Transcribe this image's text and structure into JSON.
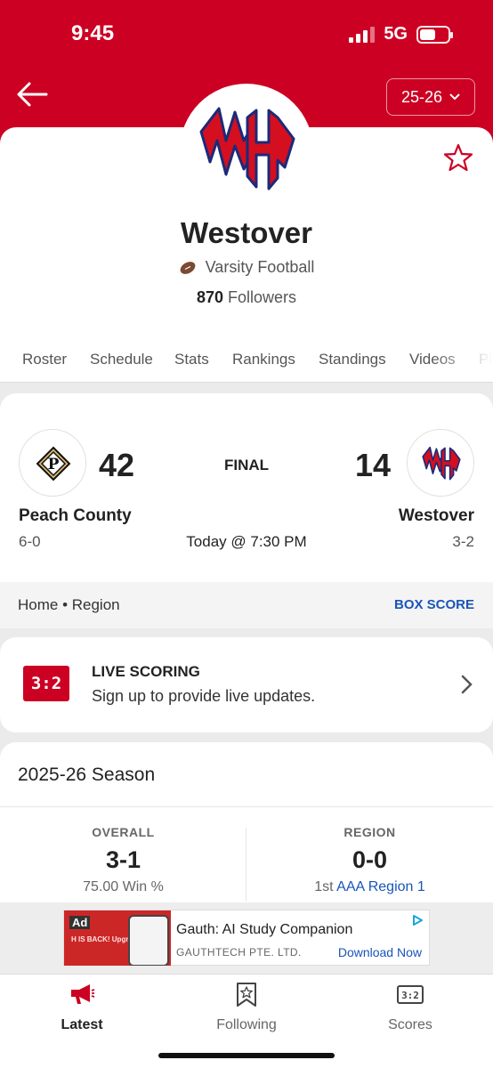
{
  "status_bar": {
    "time": "9:45",
    "network": "5G"
  },
  "header": {
    "back_icon": "back-arrow-icon",
    "season_selector": "25-26",
    "colors": {
      "brand": "#cc0022"
    }
  },
  "team": {
    "name": "Westover",
    "sport": "Varsity Football",
    "followers_count": "870",
    "followers_label": "Followers",
    "favorite_icon": "star-icon"
  },
  "tabs": [
    {
      "label": "Roster"
    },
    {
      "label": "Schedule"
    },
    {
      "label": "Stats"
    },
    {
      "label": "Rankings"
    },
    {
      "label": "Standings"
    },
    {
      "label": "Videos"
    },
    {
      "label": "Pl"
    }
  ],
  "game": {
    "status": "FINAL",
    "time": "Today @ 7:30 PM",
    "away": {
      "name": "Peach County",
      "score": "42",
      "record": "6-0",
      "logo_letter": "P"
    },
    "home": {
      "name": "Westover",
      "score": "14",
      "record": "3-2"
    },
    "type": "Home • Region",
    "box_score_label": "BOX SCORE"
  },
  "live_scoring": {
    "icon_text": "3:2",
    "title": "LIVE SCORING",
    "subtitle": "Sign up to provide live updates."
  },
  "season": {
    "title": "2025-26 Season",
    "overall": {
      "label": "OVERALL",
      "value": "3-1",
      "sub": "75.00 Win %"
    },
    "region": {
      "label": "REGION",
      "value": "0-0",
      "rank": "1st",
      "region_name": "AAA Region 1"
    }
  },
  "ad": {
    "tag": "Ad",
    "image_text": "H IS BACK! Upgraded",
    "title": "Gauth: AI Study Companion",
    "company": "GAUTHTECH PTE. LTD.",
    "cta": "Download Now"
  },
  "bottom_nav": [
    {
      "label": "Latest",
      "icon": "megaphone-icon",
      "active": true
    },
    {
      "label": "Following",
      "icon": "bookmark-star-icon",
      "active": false
    },
    {
      "label": "Scores",
      "icon": "scoreboard-icon",
      "active": false
    }
  ]
}
